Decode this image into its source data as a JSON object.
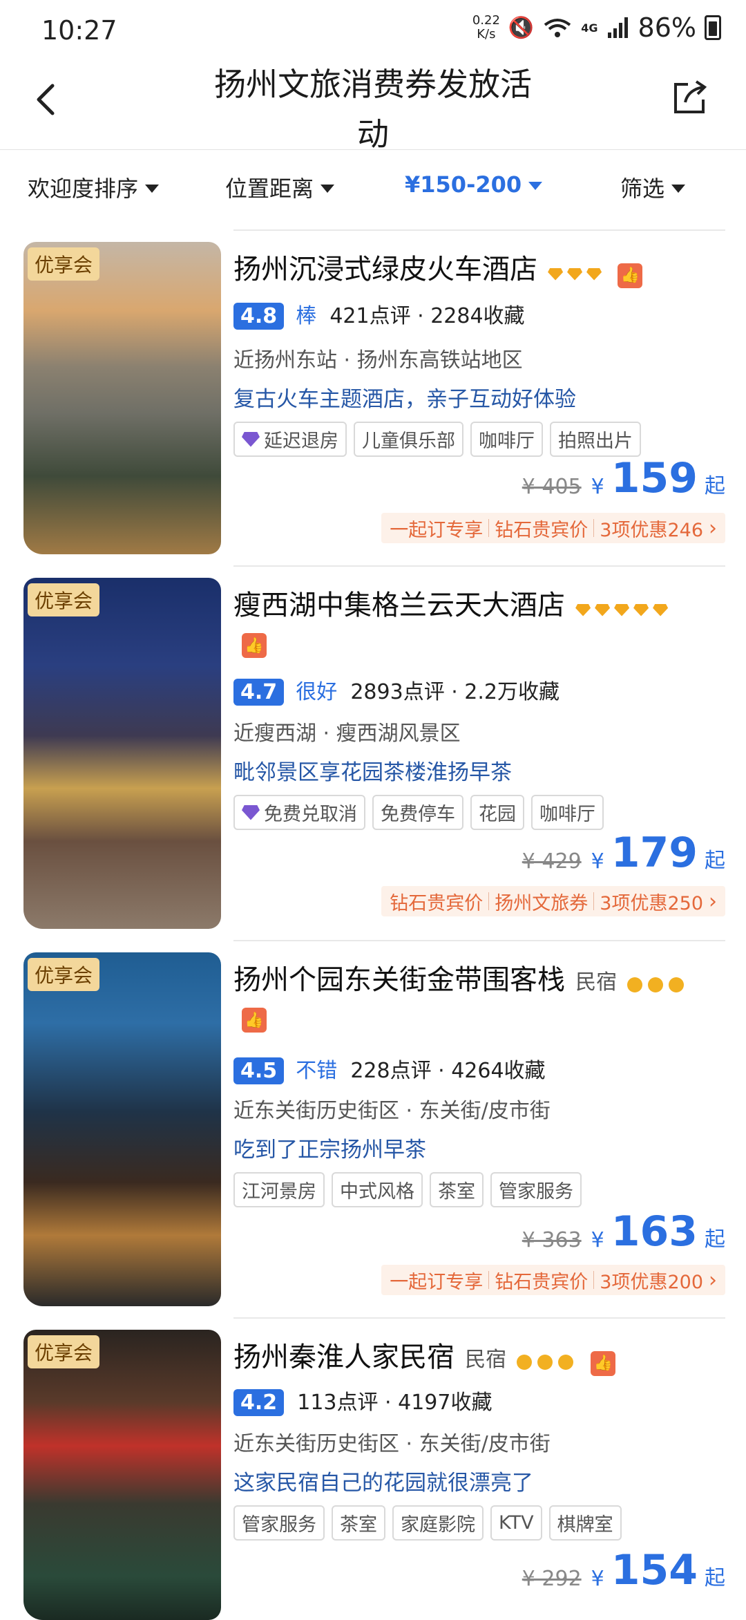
{
  "status_bar": {
    "time": "10:27",
    "net_speed_value": "0.22",
    "net_speed_unit": "K/s",
    "battery": "86%",
    "network": "4G",
    "icons": [
      "mute-icon",
      "wifi-icon",
      "signal-icon",
      "battery-icon"
    ]
  },
  "header": {
    "title": "扬州文旅消费券发放活动",
    "back_icon": "chevron-left-icon",
    "share_icon": "share-icon"
  },
  "filters": {
    "sort": "欢迎度排序",
    "distance": "位置距离",
    "price": "¥150-200",
    "filter": "筛选",
    "active_color": "#2b6fe0"
  },
  "hotels": [
    {
      "badge": "优享会",
      "name": "扬州沉浸式绿皮火车酒店",
      "type": "",
      "level_icon": "diamond",
      "level_count": 3,
      "score": "4.8",
      "rating_word": "棒",
      "reviews": "421点评 · 2284收藏",
      "location": "近扬州东站 · 扬州东高铁站地区",
      "feature": "复古火车主题酒店，亲子互动好体验",
      "tags": [
        "延迟退房",
        "儿童俱乐部",
        "咖啡厅",
        "拍照出片"
      ],
      "orig_price": "¥ 405",
      "currency": "¥",
      "price": "159",
      "price_suffix": "起",
      "promo": [
        "一起订专享",
        "钻石贵宾价",
        "3项优惠246"
      ]
    },
    {
      "badge": "优享会",
      "name": "瘦西湖中集格兰云天大酒店",
      "type": "",
      "level_icon": "diamond",
      "level_count": 5,
      "score": "4.7",
      "rating_word": "很好",
      "reviews": "2893点评 · 2.2万收藏",
      "location": "近瘦西湖 · 瘦西湖风景区",
      "feature": "毗邻景区享花园茶楼淮扬早茶",
      "tags": [
        "免费兑取消",
        "免费停车",
        "花园",
        "咖啡厅"
      ],
      "orig_price": "¥ 429",
      "currency": "¥",
      "price": "179",
      "price_suffix": "起",
      "promo": [
        "钻石贵宾价",
        "扬州文旅券",
        "3项优惠250"
      ]
    },
    {
      "badge": "优享会",
      "name": "扬州个园东关街金带围客栈",
      "type": "民宿",
      "level_icon": "dot",
      "level_count": 3,
      "score": "4.5",
      "rating_word": "不错",
      "reviews": "228点评 · 4264收藏",
      "location": "近东关街历史街区 · 东关街/皮市街",
      "feature": "吃到了正宗扬州早茶",
      "tags": [
        "江河景房",
        "中式风格",
        "茶室",
        "管家服务"
      ],
      "orig_price": "¥ 363",
      "currency": "¥",
      "price": "163",
      "price_suffix": "起",
      "promo": [
        "一起订专享",
        "钻石贵宾价",
        "3项优惠200"
      ]
    },
    {
      "badge": "优享会",
      "name": "扬州秦淮人家民宿",
      "type": "民宿",
      "level_icon": "dot",
      "level_count": 3,
      "score": "4.2",
      "rating_word": "",
      "reviews": "113点评 · 4197收藏",
      "location": "近东关街历史街区 · 东关街/皮市街",
      "feature": "这家民宿自己的花园就很漂亮了",
      "tags": [
        "管家服务",
        "茶室",
        "家庭影院",
        "KTV",
        "棋牌室"
      ],
      "orig_price": "¥ 292",
      "currency": "¥",
      "price": "154",
      "price_suffix": "起",
      "promo": []
    }
  ]
}
